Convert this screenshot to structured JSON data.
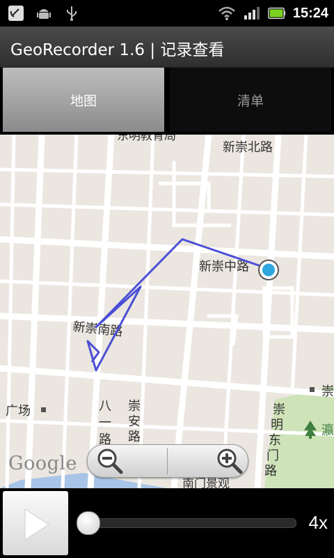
{
  "status_bar": {
    "time": "15:24",
    "left_icons": [
      "phone-alert-icon",
      "android-icon",
      "usb-icon"
    ],
    "right_icons": [
      "wifi-icon",
      "signal-icon",
      "battery-icon"
    ],
    "battery_color": "#7ad11f"
  },
  "app": {
    "title": "GeoRecorder 1.6 | 记录查看"
  },
  "tabs": [
    {
      "label": "地图",
      "selected": true
    },
    {
      "label": "清单",
      "selected": false
    }
  ],
  "map": {
    "top_cut_label": "东明教育局",
    "labels": {
      "xinchong_north": "新崇北路",
      "xinchong_mid": "新崇中路",
      "xinchong_south": "新崇南路",
      "bayi_road": "八一路",
      "chongan_road": "崇安路",
      "chongming_dongmen": "崇明东门路",
      "square": "广场",
      "right_cut": "崇",
      "right_cut2": "瀛",
      "bottom_cut": "南门景观"
    },
    "track_color": "#4b4fd6",
    "logo": "Google"
  },
  "zoom_controls": {
    "zoom_out_icon": "zoom-out-icon",
    "zoom_in_icon": "zoom-in-icon"
  },
  "playback": {
    "play_icon": "play-icon",
    "progress": 0.0,
    "speed": "4x"
  }
}
